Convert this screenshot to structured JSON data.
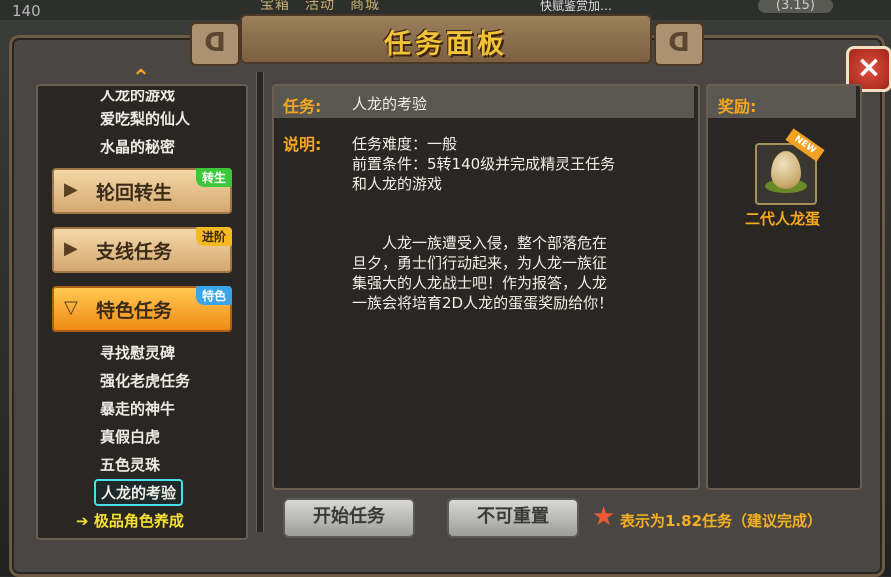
{
  "hud": {
    "level": "140",
    "timer": "(3.15)",
    "chat_fragment": "快赋鉴赏加…",
    "tabs_fragment": "宝箱　活动　商城"
  },
  "window": {
    "title": "任务面板",
    "close_label": "×"
  },
  "sidebar": {
    "partial_top_item": "人龙的游戏",
    "items_top": [
      "爱吃梨的仙人",
      "水晶的秘密"
    ],
    "categories": [
      {
        "label": "轮回转生",
        "tag": "转生",
        "tag_color": "#3cc83a"
      },
      {
        "label": "支线任务",
        "tag": "进阶",
        "tag_color": "#f4b820"
      },
      {
        "label": "特色任务",
        "tag": "特色",
        "tag_color": "#3aa4e8"
      }
    ],
    "items_special": [
      "寻找慰灵碑",
      "强化老虎任务",
      "暴走的神牛",
      "真假白虎",
      "五色灵珠"
    ],
    "selected_item": "人龙的考验",
    "recommended_item": "极品角色养成",
    "recommended_arrow": "➔"
  },
  "task": {
    "name_label": "任务:",
    "name": "人龙的考验",
    "desc_label": "说明:",
    "difficulty": "任务难度：一般",
    "prereq_line1": "前置条件：5转140级并完成精灵王任务",
    "prereq_line2": "和人龙的游戏",
    "story_lines": [
      "　　人龙一族遭受入侵，整个部落危在",
      "旦夕，勇士们行动起来，为人龙一族征",
      "集强大的人龙战士吧！作为报答，人龙",
      "一族会将培育2D人龙的蛋蛋奖励给你！"
    ]
  },
  "reward": {
    "label": "奖励:",
    "item_name": "二代人龙蛋",
    "badge": "NEW"
  },
  "actions": {
    "start": "开始任务",
    "reset": "不可重置"
  },
  "hint": "表示为1.82任务（建议完成）",
  "colors": {
    "accent_orange": "#f4a820",
    "title_gold": "#f2c338",
    "selected_border": "#4ae0e8"
  }
}
